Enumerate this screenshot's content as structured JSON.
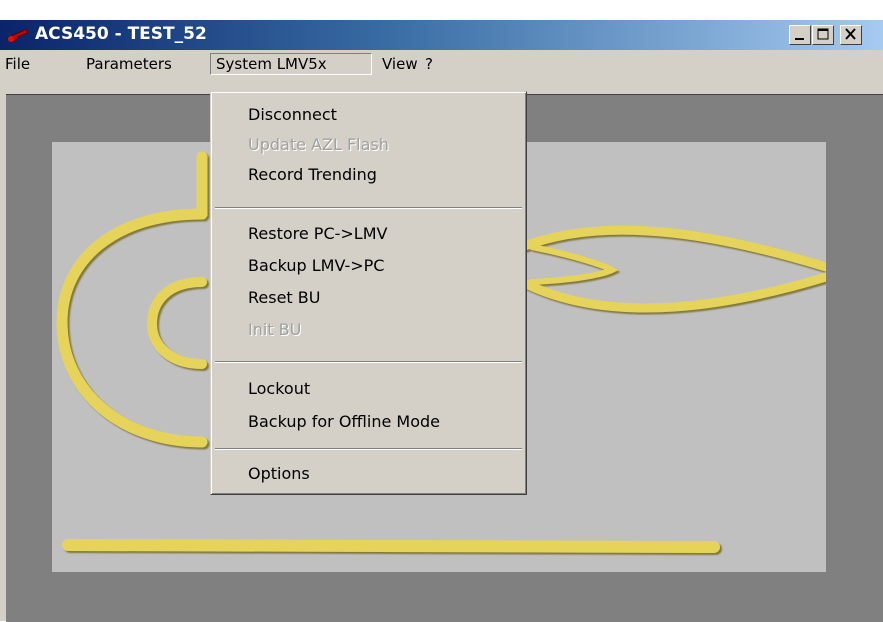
{
  "window": {
    "title": "ACS450 - TEST_52",
    "controls": [
      "minimize",
      "maximize",
      "close"
    ]
  },
  "menubar": {
    "items": [
      "File",
      "Parameters",
      "System LMV5x",
      "View",
      "?"
    ],
    "open_item": "System LMV5x"
  },
  "dropdown": {
    "items": [
      {
        "label": "Disconnect",
        "enabled": true
      },
      {
        "label": "Update AZL Flash",
        "enabled": false
      },
      {
        "label": "Record Trending",
        "enabled": true
      },
      {
        "label": "Restore PC->LMV",
        "enabled": true
      },
      {
        "label": "Backup LMV->PC",
        "enabled": true
      },
      {
        "label": "Reset BU",
        "enabled": true
      },
      {
        "label": "Init BU",
        "enabled": false
      },
      {
        "label": "Lockout",
        "enabled": true
      },
      {
        "label": "Backup for Offline Mode",
        "enabled": true
      },
      {
        "label": "Options",
        "enabled": true
      }
    ]
  },
  "colors": {
    "title_gradient_start": "#0a246a",
    "title_gradient_end": "#a6caf0",
    "window_face": "#d4d0c8",
    "client_background": "#808080",
    "panel_background": "#c0c0c0",
    "logo_gold": "#e6d45a",
    "disabled_text": "#a0a0a0"
  },
  "icons": {
    "app": "red-burner-icon",
    "minimize": "minimize-icon",
    "maximize": "maximize-icon",
    "close": "close-icon"
  }
}
